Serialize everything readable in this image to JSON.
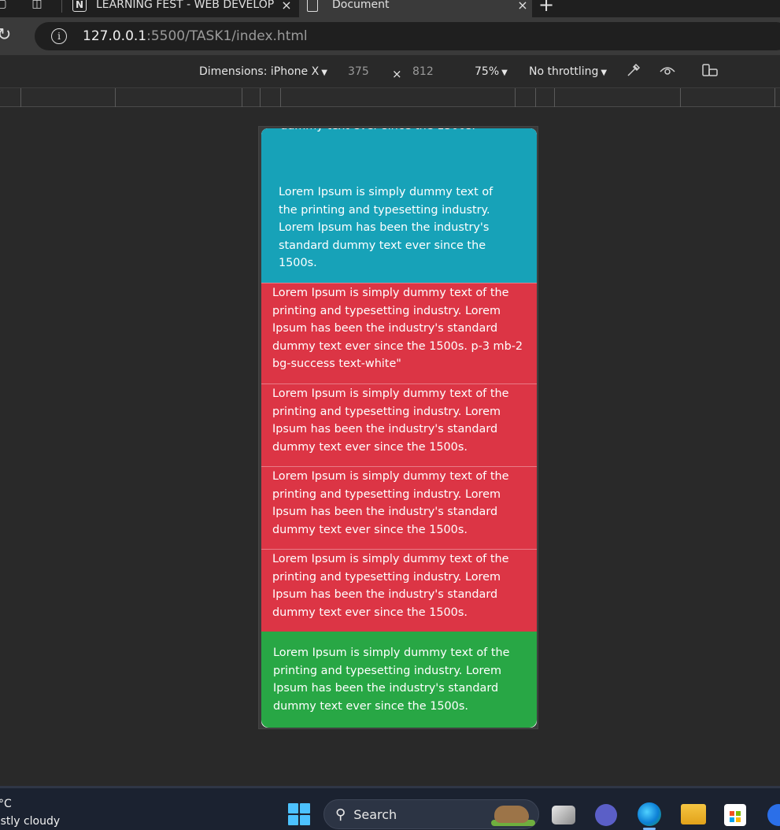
{
  "browser": {
    "tabs": [
      {
        "title": "LEARNING FEST - WEB DEVELOP",
        "favicon": "N",
        "active": false
      },
      {
        "title": "Document",
        "active": true
      }
    ],
    "close_glyph": "×",
    "new_tab_glyph": "+",
    "url": {
      "host": "127.0.0.1",
      "rest": ":5500/TASK1/index.html"
    }
  },
  "devtools": {
    "device_label": "Dimensions: iPhone X",
    "width": "375",
    "times": "×",
    "height": "812",
    "zoom": "75%",
    "throttling": "No throttling"
  },
  "page": {
    "cut_text": "dummy text ever since the 1500s.",
    "teal_text": "Lorem Ipsum is simply dummy text of the printing and typesetting industry. Lorem Ipsum has been the industry's standard dummy text ever since the 1500s.",
    "red_blocks": [
      "Lorem Ipsum is simply dummy text of the printing and typesetting industry. Lorem Ipsum has been the industry's standard dummy text ever since the 1500s. p-3 mb-2 bg-success text-white\"",
      "Lorem Ipsum is simply dummy text of the printing and typesetting industry. Lorem Ipsum has been the industry's standard dummy text ever since the 1500s.",
      "Lorem Ipsum is simply dummy text of the printing and typesetting industry. Lorem Ipsum has been the industry's standard dummy text ever since the 1500s.",
      "Lorem Ipsum is simply dummy text of the printing and typesetting industry. Lorem Ipsum has been the industry's standard dummy text ever since the 1500s."
    ],
    "green_text": "Lorem Ipsum is simply dummy text of the printing and typesetting industry. Lorem Ipsum has been the industry's standard dummy text ever since the 1500s.",
    "colors": {
      "teal": "#17a2b8",
      "red": "#dc3545",
      "green": "#28a745"
    }
  },
  "taskbar": {
    "weather_temp": "°C",
    "weather_desc": "ostly cloudy",
    "search_label": "Search"
  }
}
